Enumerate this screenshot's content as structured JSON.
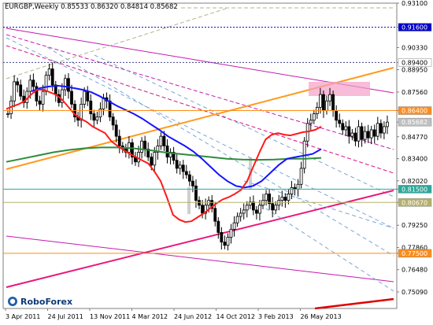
{
  "chart_data": {
    "type": "candlestick",
    "title": "EURGBP,Weekly  0.85533 0.86320 0.84814 0.85682",
    "brand": "RoboForex",
    "ylim": [
      0.7406,
      0.931
    ],
    "y_ticks": [
      "0.93100",
      "0.91600",
      "0.90330",
      "0.89400",
      "0.88950",
      "0.87560",
      "0.86400",
      "0.85682",
      "0.84770",
      "0.83400",
      "0.82020",
      "0.81500",
      "0.80670",
      "0.79250",
      "0.77860",
      "0.77500",
      "0.76480",
      "0.75090"
    ],
    "x_ticks": [
      "3 Apr 2011",
      "24 Jul 2011",
      "13 Nov 2011",
      "4 Mar 2012",
      "24 Jun 2012",
      "14 Oct 2012",
      "3 Feb 2013",
      "26 May 2013"
    ],
    "price_tags": [
      {
        "label": "0.91600",
        "bg": "#0000cc",
        "fg": "#ffffff"
      },
      {
        "label": "0.89400",
        "bg": "#ffffff",
        "fg": "#000000"
      },
      {
        "label": "0.86400",
        "bg": "#ff8c1a",
        "fg": "#ffffff"
      },
      {
        "label": "0.85682",
        "bg": "#c0c0c0",
        "fg": "#ffffff"
      },
      {
        "label": "0.81500",
        "bg": "#2aa89a",
        "fg": "#ffffff"
      },
      {
        "label": "0.80670",
        "bg": "#b5b06a",
        "fg": "#ffffff"
      },
      {
        "label": "0.77500",
        "bg": "#ff8c1a",
        "fg": "#ffffff"
      }
    ],
    "levels": [
      {
        "value": 0.916,
        "color": "#0000cc",
        "dash": "2,2"
      },
      {
        "value": 0.894,
        "color": "#404090",
        "dash": "2,2"
      },
      {
        "value": 0.864,
        "color": "#ff8c1a",
        "dash": ""
      },
      {
        "value": 0.815,
        "color": "#2aa89a",
        "dash": ""
      },
      {
        "value": 0.8067,
        "color": "#b5b06a",
        "dash": ""
      },
      {
        "value": 0.775,
        "color": "#ff8c1a",
        "dash": ""
      }
    ],
    "closes": [
      0.862,
      0.87,
      0.882,
      0.88,
      0.873,
      0.869,
      0.876,
      0.883,
      0.879,
      0.87,
      0.868,
      0.876,
      0.886,
      0.89,
      0.88,
      0.874,
      0.869,
      0.877,
      0.884,
      0.876,
      0.868,
      0.86,
      0.858,
      0.868,
      0.876,
      0.87,
      0.862,
      0.858,
      0.86,
      0.865,
      0.872,
      0.87,
      0.86,
      0.855,
      0.848,
      0.842,
      0.84,
      0.838,
      0.844,
      0.835,
      0.832,
      0.838,
      0.845,
      0.84,
      0.835,
      0.83,
      0.838,
      0.842,
      0.848,
      0.842,
      0.835,
      0.838,
      0.833,
      0.828,
      0.83,
      0.826,
      0.824,
      0.82,
      0.817,
      0.808,
      0.805,
      0.8,
      0.805,
      0.808,
      0.803,
      0.795,
      0.788,
      0.782,
      0.78,
      0.785,
      0.79,
      0.794,
      0.798,
      0.8,
      0.802,
      0.805,
      0.807,
      0.802,
      0.8,
      0.805,
      0.808,
      0.812,
      0.806,
      0.802,
      0.805,
      0.808,
      0.81,
      0.808,
      0.812,
      0.816,
      0.815,
      0.818,
      0.828,
      0.845,
      0.856,
      0.858,
      0.862,
      0.866,
      0.874,
      0.864,
      0.87,
      0.874,
      0.864,
      0.858,
      0.856,
      0.852,
      0.854,
      0.848,
      0.85,
      0.845,
      0.854,
      0.846,
      0.851,
      0.847,
      0.852,
      0.848,
      0.856,
      0.85,
      0.854,
      0.8568
    ],
    "ma_red": [
      0.865,
      0.8666,
      0.868,
      0.87,
      0.874,
      0.877,
      0.877,
      0.8755,
      0.874,
      0.871,
      0.8665,
      0.862,
      0.859,
      0.857,
      0.854,
      0.852,
      0.85,
      0.845,
      0.842,
      0.8395,
      0.837,
      0.835,
      0.833,
      0.831,
      0.826,
      0.82,
      0.81,
      0.799,
      0.796,
      0.7945,
      0.795,
      0.7975,
      0.8,
      0.803,
      0.806,
      0.8085,
      0.81,
      0.812,
      0.8145,
      0.82,
      0.829,
      0.838,
      0.846,
      0.849,
      0.85,
      0.849,
      0.8485,
      0.8495,
      0.8505,
      0.851,
      0.852,
      0.854
    ],
    "ma_blue": [
      0.876,
      0.878,
      0.879,
      0.8795,
      0.879,
      0.878,
      0.877,
      0.8755,
      0.873,
      0.87,
      0.867,
      0.8645,
      0.862,
      0.859,
      0.8555,
      0.852,
      0.848,
      0.845,
      0.842,
      0.8385,
      0.834,
      0.829,
      0.824,
      0.82,
      0.817,
      0.816,
      0.817,
      0.82,
      0.825,
      0.83,
      0.834,
      0.835,
      0.836,
      0.837,
      0.84
    ],
    "ma_green": [
      0.832,
      0.834,
      0.836,
      0.838,
      0.8395,
      0.8405,
      0.841,
      0.841,
      0.8405,
      0.8395,
      0.838,
      0.837,
      0.836,
      0.835,
      0.834,
      0.8335,
      0.8333,
      0.8335,
      0.834,
      0.834,
      0.8345
    ]
  }
}
